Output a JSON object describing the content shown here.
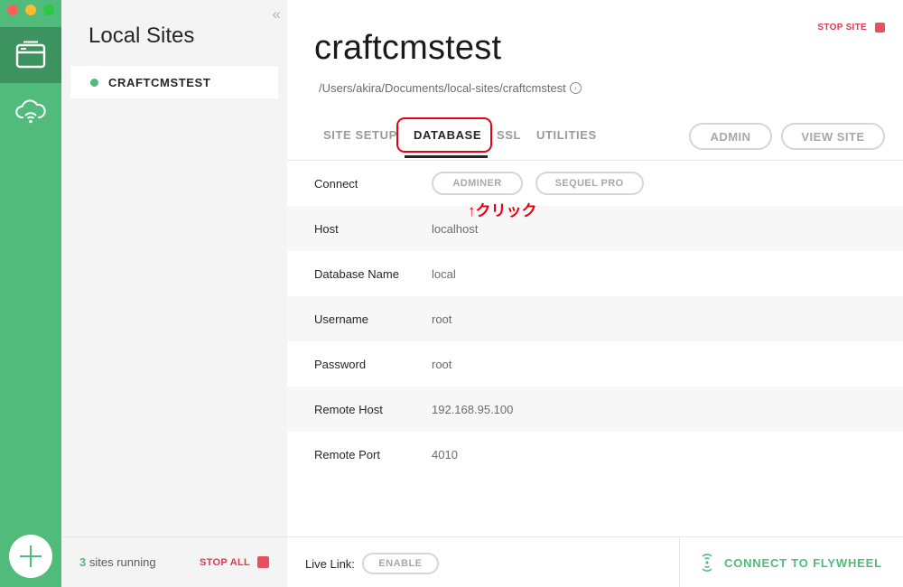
{
  "sidebar": {
    "title": "Local Sites",
    "collapse_icon": "«",
    "sites": [
      {
        "name": "CRAFTCMSTEST",
        "status_color": "#51bb7b"
      }
    ],
    "footer": {
      "running_count": "3",
      "running_text": " sites running",
      "stop_all_label": "STOP ALL"
    }
  },
  "site": {
    "title": "craftcmstest",
    "path": "/Users/akira/Documents/local-sites/craftcmstest",
    "stop_site_label": "STOP SITE"
  },
  "tabs": {
    "setup": "SITE SETUP",
    "database": "DATABASE",
    "ssl": "SSL",
    "utilities": "UTILITIES"
  },
  "header_buttons": {
    "admin": "ADMIN",
    "view_site": "VIEW SITE"
  },
  "database": {
    "connect_label": "Connect",
    "adminer_label": "ADMINER",
    "sequel_pro_label": "SEQUEL PRO",
    "annotation": "↑クリック",
    "fields": [
      {
        "label": "Host",
        "value": "localhost"
      },
      {
        "label": "Database Name",
        "value": "local"
      },
      {
        "label": "Username",
        "value": "root"
      },
      {
        "label": "Password",
        "value": "root"
      },
      {
        "label": "Remote Host",
        "value": "192.168.95.100"
      },
      {
        "label": "Remote Port",
        "value": "4010"
      }
    ]
  },
  "footer": {
    "live_link_label": "Live Link:",
    "enable_label": "ENABLE",
    "flywheel_label": "CONNECT TO FLYWHEEL"
  },
  "colors": {
    "accent_green": "#51bb7b",
    "rail_active": "#3c9360",
    "stop_red": "#e2384f",
    "annotation_red": "#e60012"
  }
}
